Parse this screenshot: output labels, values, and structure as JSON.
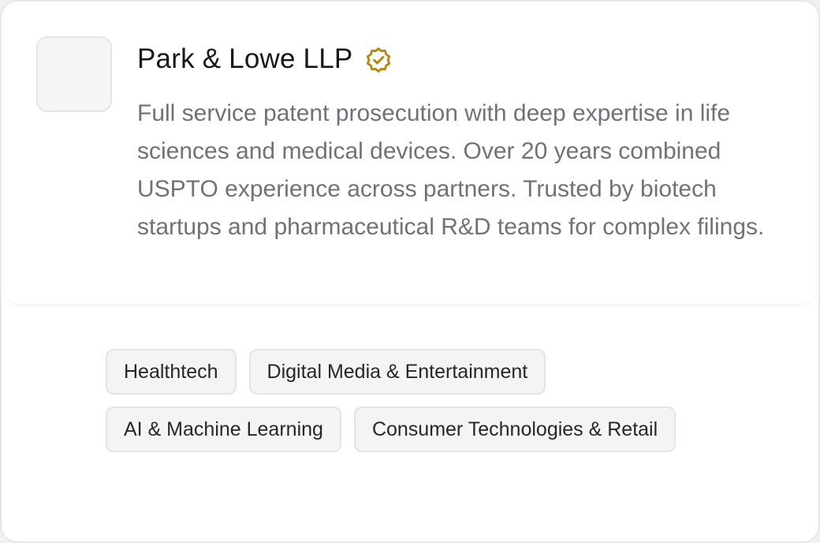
{
  "firm": {
    "name": "Park & Lowe LLP",
    "verified_icon": "verified-badge-icon",
    "description": "Full service patent prosecution with deep expertise in life sciences and medical devices. Over 20 years combined USPTO experience across partners. Trusted by biotech startups and pharmaceutical R&D teams for complex filings."
  },
  "tags": [
    "Healthtech",
    "Digital Media & Entertainment",
    "AI & Machine Learning",
    "Consumer Technologies & Retail"
  ],
  "colors": {
    "verified_badge": "#b8860b",
    "title": "#18181b",
    "description": "#71717a",
    "tag_background": "#f4f4f5"
  }
}
